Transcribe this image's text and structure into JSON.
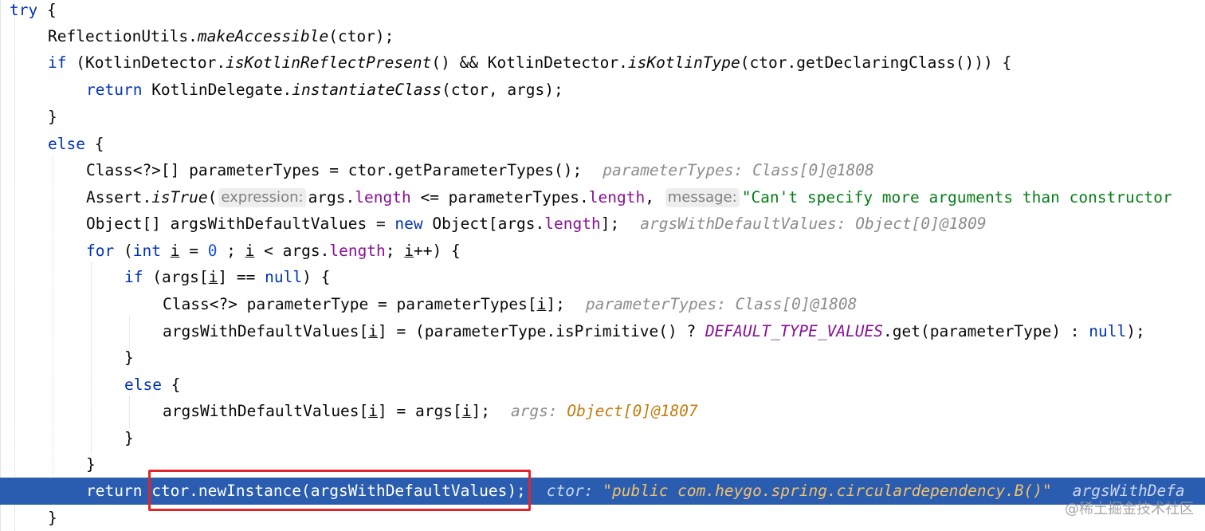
{
  "code": {
    "l1_try": "try",
    "l1_brace": " {",
    "l2_cls": "ReflectionUtils.",
    "l2_mth": "makeAccessible",
    "l2_rest": "(ctor);",
    "l3_if": "if",
    "l3_a": " (KotlinDetector.",
    "l3_b": "isKotlinReflectPresent",
    "l3_c": "() && KotlinDetector.",
    "l3_d": "isKotlinType",
    "l3_e": "(ctor.getDeclaringClass())) {",
    "l4_ret": "return",
    "l4_a": " KotlinDelegate.",
    "l4_b": "instantiateClass",
    "l4_c": "(ctor, args);",
    "l5": "}",
    "l6_else": "else",
    "l6_brace": " {",
    "l7_code": "Class<?>[] parameterTypes = ctor.getParameterTypes();",
    "l7_val": "parameterTypes: Class[0]@1808",
    "l8_a": "Assert.",
    "l8_b": "isTrue",
    "l8_c": "(",
    "l8_hint1": "expression:",
    "l8_d": "args.",
    "l8_e": "length",
    "l8_f": " <= parameterTypes.",
    "l8_g": "length",
    "l8_h": ",",
    "l8_hint2": "message:",
    "l8_str": "\"Can't specify more arguments than constructor",
    "l9_a": "Object[] argsWithDefaultValues = ",
    "l9_new": "new",
    "l9_b": " Object[args.",
    "l9_c": "length",
    "l9_d": "];",
    "l9_val": "argsWithDefaultValues: Object[0]@1809",
    "l10_for": "for",
    "l10_a": " (",
    "l10_int": "int",
    "l10_sp": " ",
    "l10_i1": "i",
    "l10_b": " = ",
    "l10_zero": "0",
    "l10_c": " ; ",
    "l10_i2": "i",
    "l10_d": " < args.",
    "l10_len": "length",
    "l10_e": "; ",
    "l10_i3": "i",
    "l10_f": "++) {",
    "l11_if": "if",
    "l11_a": " (args[",
    "l11_i": "i",
    "l11_b": "] == ",
    "l11_null": "null",
    "l11_c": ") {",
    "l12_code": "Class<?> parameterType = parameterTypes[",
    "l12_i": "i",
    "l12_end": "];",
    "l12_val": "parameterTypes: Class[0]@1808",
    "l13_a": "argsWithDefaultValues[",
    "l13_i": "i",
    "l13_b": "] = (parameterType.isPrimitive() ? ",
    "l13_const": "DEFAULT_TYPE_VALUES",
    "l13_c": ".get(parameterType) : ",
    "l13_null": "null",
    "l13_d": ");",
    "l14": "}",
    "l15_else": "else",
    "l15_brace": " {",
    "l16_a": "argsWithDefaultValues[",
    "l16_i1": "i",
    "l16_b": "] = args[",
    "l16_i2": "i",
    "l16_c": "];",
    "l16_val_name": "args: ",
    "l16_val_ref": "Object[0]@1807",
    "l17": "}",
    "l18": "}",
    "l19_ret": "return",
    "l19_a": " ctor.newInstance(argsWithDefaultValues);",
    "l19_val_name": "ctor: ",
    "l19_val_str": "\"public com.heygo.spring.circulardependency.B()\"",
    "l19_val_more": "argsWithDefa",
    "l20": "}"
  },
  "watermark": "@稀土掘金技术社区",
  "colors": {
    "keyword": "#0033b3",
    "field": "#871094",
    "string": "#067d17",
    "number": "#1750eb",
    "execution_line": "#2a5db0",
    "highlight_box": "#e0262d"
  }
}
